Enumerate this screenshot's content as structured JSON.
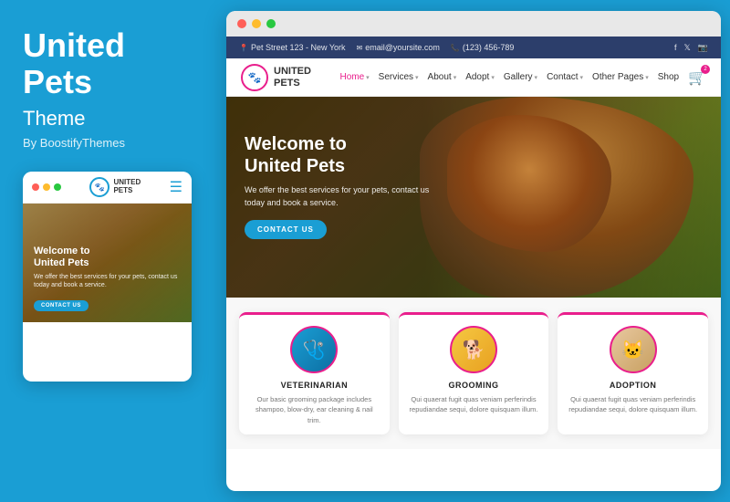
{
  "left": {
    "title_line1": "United",
    "title_line2": "Pets",
    "subtitle": "Theme",
    "author": "By BoostifyThemes"
  },
  "mobile": {
    "logo_text_line1": "UNITED",
    "logo_text_line2": "PETS",
    "hero_title_line1": "Welcome to",
    "hero_title_line2": "United Pets",
    "hero_text": "We offer the best services for your pets, contact us today and book a service.",
    "cta_label": "CONTACT US"
  },
  "desktop": {
    "topbar": {
      "address": "Pet Street 123 - New York",
      "email": "email@yoursite.com",
      "phone": "(123) 456-789"
    },
    "logo_text_line1": "UNITED",
    "logo_text_line2": "PETS",
    "nav_items": [
      {
        "label": "Home",
        "active": true,
        "has_dropdown": true
      },
      {
        "label": "Services",
        "has_dropdown": true
      },
      {
        "label": "About",
        "has_dropdown": true
      },
      {
        "label": "Adopt",
        "has_dropdown": true
      },
      {
        "label": "Gallery",
        "has_dropdown": true
      },
      {
        "label": "Contact",
        "has_dropdown": true
      },
      {
        "label": "Other Pages",
        "has_dropdown": true
      },
      {
        "label": "Shop"
      }
    ],
    "hero": {
      "title_line1": "Welcome to",
      "title_line2": "United Pets",
      "text": "We offer the best services for your pets, contact us today and book a service.",
      "cta_label": "CONTACT US"
    },
    "cards": [
      {
        "icon": "🩺",
        "title": "VETERINARIAN",
        "text": "Our basic grooming package includes shampoo, blow-dry, ear cleaning & nail trim."
      },
      {
        "icon": "🐕",
        "title": "GROOMING",
        "text": "Qui quaerat fugit quas veniam perferindis repudiandae sequi, dolore quisquam illum."
      },
      {
        "icon": "🐱",
        "title": "ADOPTION",
        "text": "Qui quaerat fugit quas veniam perferindis repudiandae sequi, dolore quisquam illum."
      }
    ]
  },
  "colors": {
    "blue": "#1a9ed4",
    "pink": "#e91e8c",
    "dark_nav": "#2c3e6b",
    "dot_red": "#ff5f57",
    "dot_yellow": "#febc2e",
    "dot_green": "#28c840",
    "mobile_dot_red": "#ff5f57",
    "mobile_dot_yellow": "#febc2e",
    "mobile_dot_green": "#28c840"
  }
}
